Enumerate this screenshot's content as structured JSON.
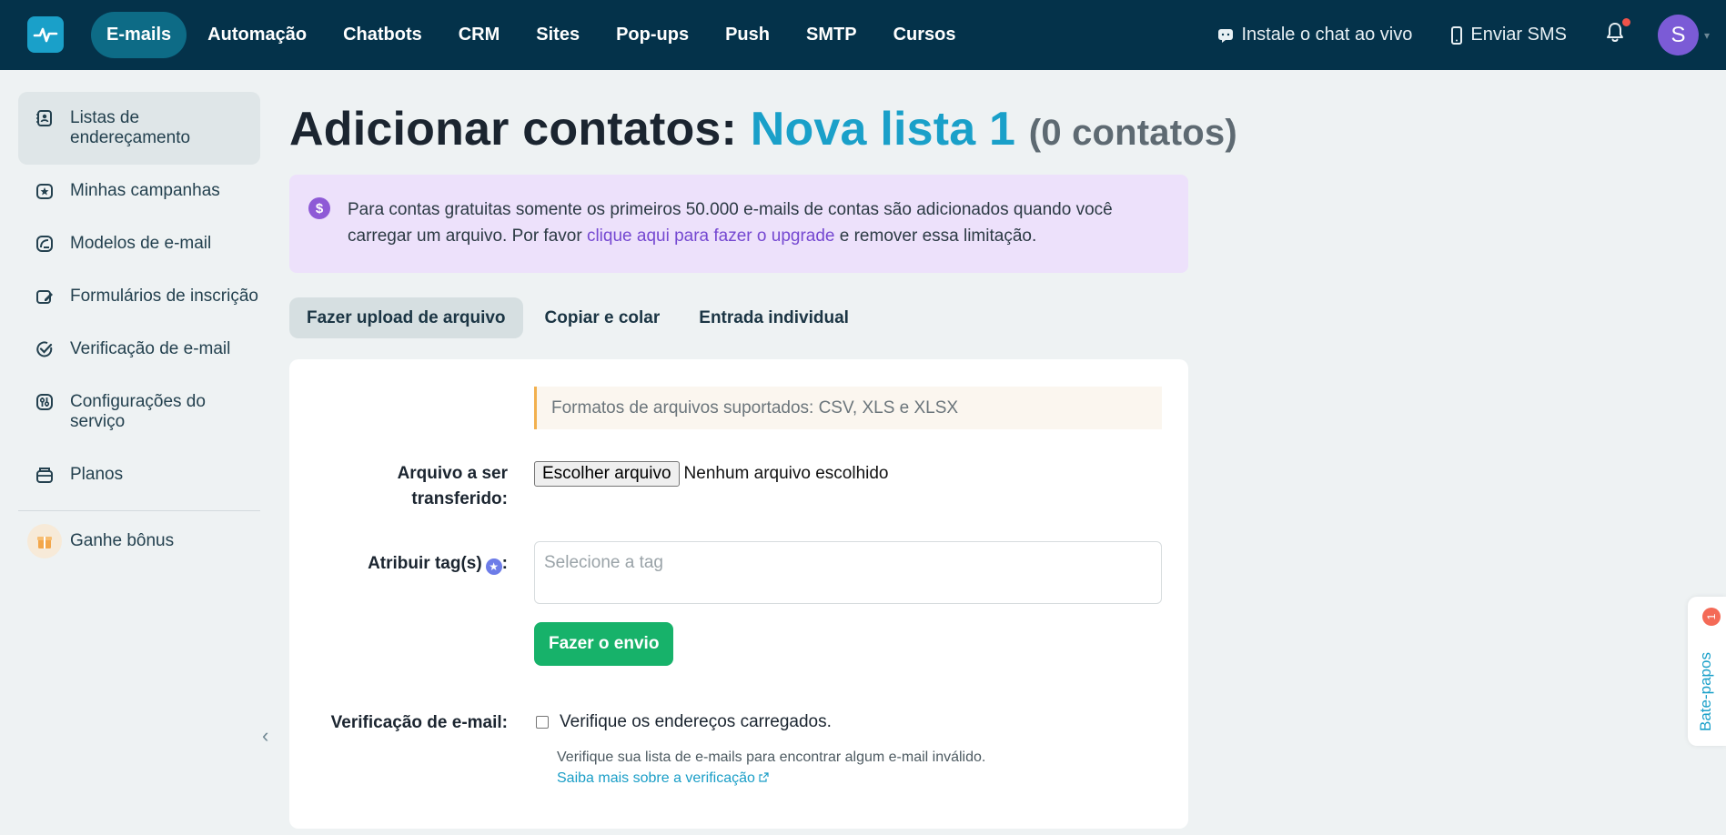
{
  "nav": {
    "items": [
      {
        "label": "E-mails",
        "active": true
      },
      {
        "label": "Automação"
      },
      {
        "label": "Chatbots"
      },
      {
        "label": "CRM"
      },
      {
        "label": "Sites"
      },
      {
        "label": "Pop-ups"
      },
      {
        "label": "Push"
      },
      {
        "label": "SMTP"
      },
      {
        "label": "Cursos"
      }
    ],
    "live_chat": "Instale o chat ao vivo",
    "send_sms": "Enviar SMS",
    "avatar_initial": "S"
  },
  "sidebar": {
    "items": [
      {
        "label": "Listas de endereçamento",
        "icon": "contacts-book-icon",
        "active": true
      },
      {
        "label": "Minhas campanhas",
        "icon": "campaign-icon"
      },
      {
        "label": "Modelos de e-mail",
        "icon": "template-icon"
      },
      {
        "label": "Formulários de inscrição",
        "icon": "form-edit-icon"
      },
      {
        "label": "Verificação de e-mail",
        "icon": "check-circle-icon"
      },
      {
        "label": "Configurações do serviço",
        "icon": "settings-sliders-icon"
      },
      {
        "label": "Planos",
        "icon": "wallet-icon"
      }
    ],
    "bonus": "Ganhe bônus"
  },
  "page": {
    "title_prefix": "Adicionar contatos:",
    "list_name": "Nova lista 1",
    "count": "(0 contatos)"
  },
  "notice": {
    "text_before": "Para contas gratuitas somente os primeiros 50.000 e-mails de contas são adicionados quando você carregar um arquivo. Por favor ",
    "link": "clique aqui para fazer o upgrade",
    "text_after": " e remover essa limitação."
  },
  "tabs": [
    {
      "label": "Fazer upload de arquivo",
      "active": true
    },
    {
      "label": "Copiar e colar"
    },
    {
      "label": "Entrada individual"
    }
  ],
  "form": {
    "formats": "Formatos de arquivos suportados: CSV, XLS e XLSX",
    "file_label": "Arquivo a ser transferido:",
    "file_button": "Escolher arquivo",
    "file_status": "Nenhum arquivo escolhido",
    "tag_label": "Atribuir tag(s)",
    "tag_colon": ":",
    "tag_placeholder": "Selecione a tag",
    "submit": "Fazer o envio",
    "verify_label": "Verificação de e-mail:",
    "verify_checkbox": "Verifique os endereços carregados.",
    "verify_help": "Verifique sua lista de e-mails para encontrar algum e-mail inválido.",
    "verify_link": "Saiba mais sobre a verificação"
  },
  "chat": {
    "label": "Bate-papos",
    "badge": "1"
  }
}
